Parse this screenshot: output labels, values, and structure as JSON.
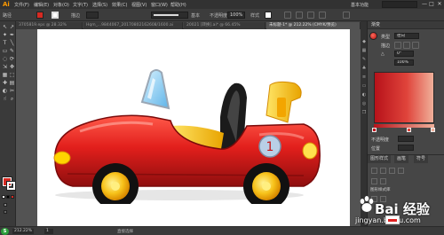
{
  "app": {
    "logo": "Ai"
  },
  "menubar": {
    "items": [
      "文件(F)",
      "编辑(E)",
      "对象(O)",
      "文字(T)",
      "选择(S)",
      "效果(C)",
      "视图(V)",
      "窗口(W)",
      "帮助(H)"
    ],
    "workspace": "基本功能",
    "window_buttons": [
      "—",
      "□",
      "✕"
    ]
  },
  "controlbar": {
    "selection_label": "路径",
    "stroke_label": "描边",
    "stroke_width": "",
    "brush_label": "基本",
    "opacity_label": "不透明度",
    "opacity_value": "100%",
    "style_label": "样式"
  },
  "tabs": [
    {
      "label": "3705819.eps @ 28.32%"
    },
    {
      "label": "Hqm_...9844067_20170802162608/1600.ai"
    },
    {
      "label": "20021 [转换].ai* @ 66.45%"
    },
    {
      "label": "未标题-1* @ 212.22% (CMYK/预览)"
    }
  ],
  "tools": [
    "↖",
    "↗",
    "✦",
    "✒",
    "T",
    "╲",
    "▭",
    "✎",
    "◌",
    "⟳",
    "⇲",
    "✥",
    "▦",
    "⬚",
    "✚",
    "▤",
    "◐",
    "✂",
    "☝",
    "⌕"
  ],
  "colors": {
    "fill": "#d62a22",
    "ui_bg": "#535353",
    "panel": "#464646"
  },
  "gradient_panel": {
    "title": "渐变",
    "type_label": "类型",
    "type_value": "径向",
    "stroke_label": "描边",
    "angle_label": "△",
    "angle_value": "0°",
    "ratio_label": "",
    "ratio_value": "100%",
    "opacity_label": "不透明度",
    "location_label": "位置"
  },
  "layers_panel": {
    "tabs": [
      "图形样式",
      "画笔",
      "符号"
    ],
    "rows": [
      "图形样式库",
      "",
      ""
    ]
  },
  "status": {
    "badge": "S",
    "zoom": "212.22%",
    "page": "1",
    "tool_name": "直接选择"
  },
  "watermark": {
    "brand": "Bai 经验",
    "url": "jingyan.baidu.com"
  }
}
